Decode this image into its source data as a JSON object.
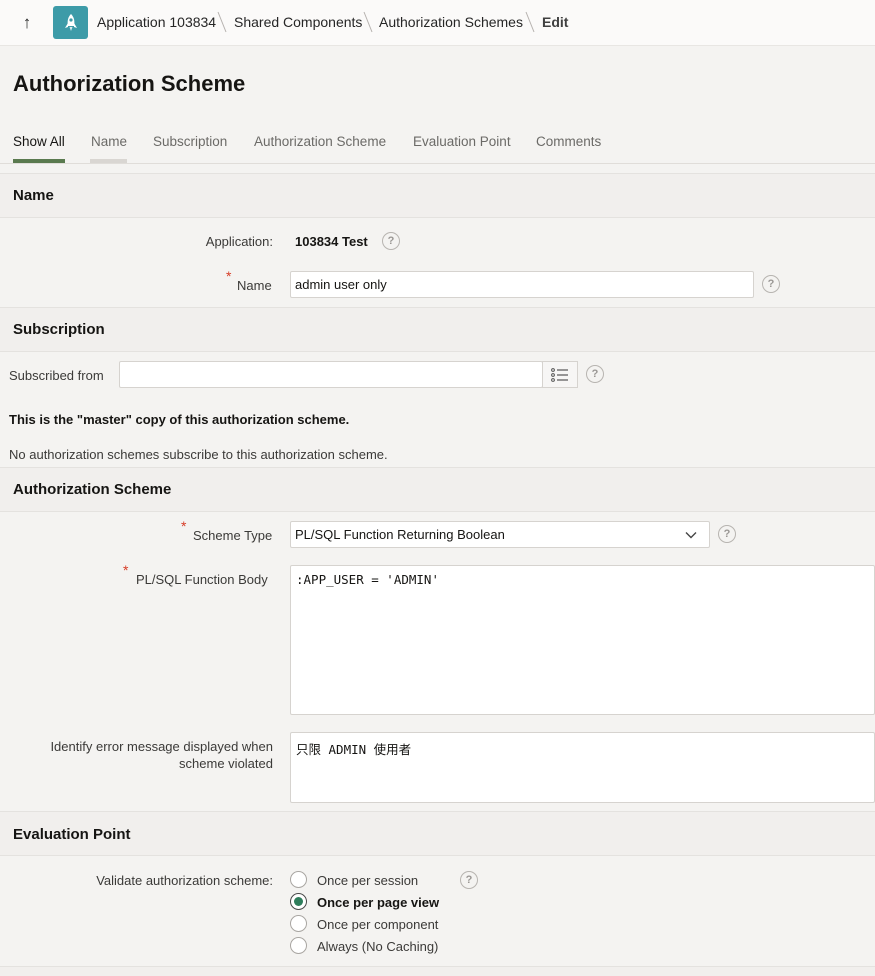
{
  "breadcrumb": {
    "items": [
      "Application 103834",
      "Shared Components",
      "Authorization Schemes"
    ],
    "current": "Edit"
  },
  "page": {
    "title": "Authorization Scheme"
  },
  "tabs": [
    {
      "label": "Show All",
      "active": true
    },
    {
      "label": "Name"
    },
    {
      "label": "Subscription"
    },
    {
      "label": "Authorization Scheme"
    },
    {
      "label": "Evaluation Point"
    },
    {
      "label": "Comments"
    }
  ],
  "name_region": {
    "title": "Name",
    "application_label": "Application:",
    "application_value": "103834 Test",
    "name_label": "Name",
    "name_value": "admin user only"
  },
  "subscription": {
    "title": "Subscription",
    "subscribed_from_label": "Subscribed from",
    "subscribed_from_value": "",
    "master_text": "This is the \"master\" copy of this authorization scheme.",
    "no_subscribers_text": "No authorization schemes subscribe to this authorization scheme."
  },
  "auth_scheme": {
    "title": "Authorization Scheme",
    "scheme_type_label": "Scheme Type",
    "scheme_type_value": "PL/SQL Function Returning Boolean",
    "function_body_label": "PL/SQL Function Body",
    "function_body_value": ":APP_USER = 'ADMIN'",
    "error_label_line1": "Identify error message displayed when",
    "error_label_line2": "scheme violated",
    "error_value": "只限 ADMIN 使用者"
  },
  "evaluation": {
    "title": "Evaluation Point",
    "validate_label": "Validate authorization scheme:",
    "options": [
      {
        "label": "Once per session",
        "checked": false
      },
      {
        "label": "Once per page view",
        "checked": true
      },
      {
        "label": "Once per component",
        "checked": false
      },
      {
        "label": "Always (No Caching)",
        "checked": false
      }
    ]
  },
  "colors": {
    "accent": "#5a7a4f",
    "app_icon": "#3d9ba8",
    "required": "#d63b25"
  },
  "help_glyph": "?"
}
